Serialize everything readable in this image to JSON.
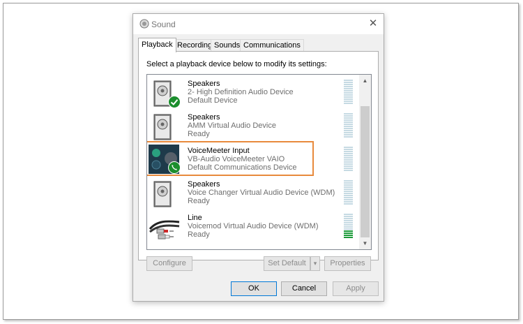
{
  "dialog": {
    "title": "Sound",
    "close_label": "✕"
  },
  "tabs": [
    {
      "label": "Playback",
      "active": true
    },
    {
      "label": "Recording",
      "active": false
    },
    {
      "label": "Sounds",
      "active": false
    },
    {
      "label": "Communications",
      "active": false
    }
  ],
  "instruction": "Select a playback device below to modify its settings:",
  "devices": [
    {
      "name": "Speakers",
      "description": "2- High Definition Audio Device",
      "state": "Default Device",
      "icon": "speaker-icon",
      "badge": "default-check-icon",
      "meter_level": 0
    },
    {
      "name": "Speakers",
      "description": "AMM Virtual Audio Device",
      "state": "Ready",
      "icon": "speaker-icon",
      "badge": "",
      "meter_level": 0
    },
    {
      "name": "VoiceMeeter Input",
      "description": "VB-Audio VoiceMeeter VAIO",
      "state": "Default Communications Device",
      "icon": "voicemeeter-icon",
      "badge": "phone-icon",
      "meter_level": 0
    },
    {
      "name": "Speakers",
      "description": "Voice Changer Virtual Audio Device (WDM)",
      "state": "Ready",
      "icon": "speaker-icon",
      "badge": "",
      "meter_level": 0
    },
    {
      "name": "Line",
      "description": "Voicemod Virtual Audio Device (WDM)",
      "state": "Ready",
      "icon": "rca-cable-icon",
      "badge": "",
      "meter_level": 0.35
    }
  ],
  "buttons": {
    "configure": "Configure",
    "set_default": "Set Default",
    "set_default_arrow": "▾",
    "properties": "Properties",
    "ok": "OK",
    "cancel": "Cancel",
    "apply": "Apply"
  },
  "colors": {
    "highlight_outline": "#e88a3c",
    "meter_off": "#c6dae3",
    "meter_on": "#1c9b3a",
    "check_badge": "#1b8e2d"
  }
}
